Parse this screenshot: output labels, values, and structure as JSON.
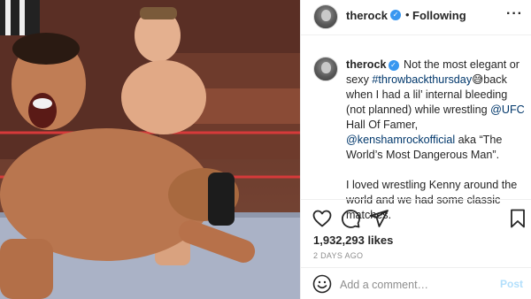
{
  "post": {
    "photo_alt": "wrestling photo",
    "header": {
      "username": "therock",
      "verified_mark": "✓",
      "separator": "•",
      "follow_status": "Following",
      "more_label": "···"
    },
    "caption": {
      "username": "therock",
      "verified_mark": "✓",
      "line_1": "Not the most elegant or sexy ",
      "hashtag": "#throwbackthursday",
      "emoji": "😅",
      "line_2": "back when I had a lil’ internal bleeding (not planned) while wrestling ",
      "mention_1": "@UFC",
      "line_3": " Hall Of Famer, ",
      "mention_2": "@kenshamrockofficial",
      "line_4": " aka “The World’s Most Dangerous Man”.",
      "paragraph_2": "I loved wrestling Kenny around the world and we had some classic matches."
    },
    "actions": {
      "like_icon": "heart-icon",
      "comment_icon": "comment-icon",
      "share_icon": "paper-plane-icon",
      "save_icon": "bookmark-icon"
    },
    "likes": "1,932,293 likes",
    "timestamp": "2 DAYS AGO",
    "comment": {
      "emoji_icon": "smiley-icon",
      "placeholder": "Add a comment…",
      "post_label": "Post"
    }
  },
  "colors": {
    "link": "#00376b",
    "verified": "#3897f0",
    "muted": "#8e8e8e",
    "post_disabled": "#b2dffc"
  }
}
